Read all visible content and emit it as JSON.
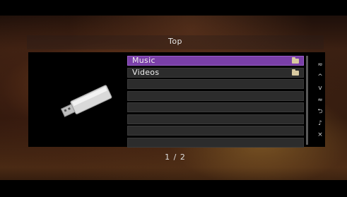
{
  "header": {
    "title": "Top"
  },
  "list": {
    "items": [
      {
        "label": "Music",
        "selected": true,
        "icon": "folder-icon"
      },
      {
        "label": "Videos",
        "selected": false,
        "icon": "folder-icon"
      },
      {
        "label": "",
        "selected": false
      },
      {
        "label": "",
        "selected": false
      },
      {
        "label": "",
        "selected": false
      },
      {
        "label": "",
        "selected": false
      },
      {
        "label": "",
        "selected": false
      },
      {
        "label": "",
        "selected": false
      }
    ]
  },
  "nav": {
    "buttons": [
      {
        "name": "page-up-icon",
        "glyph": "≈"
      },
      {
        "name": "up-icon",
        "glyph": "^"
      },
      {
        "name": "down-icon",
        "glyph": "v"
      },
      {
        "name": "page-down-icon",
        "glyph": "≈"
      },
      {
        "name": "return-icon",
        "glyph": "⮌"
      },
      {
        "name": "music-note-icon",
        "glyph": "♪"
      },
      {
        "name": "close-icon",
        "glyph": "×"
      }
    ]
  },
  "pager": {
    "text": "1 / 2"
  },
  "colors": {
    "selection": "#7a3fa8",
    "row": "#2c2c2c"
  }
}
